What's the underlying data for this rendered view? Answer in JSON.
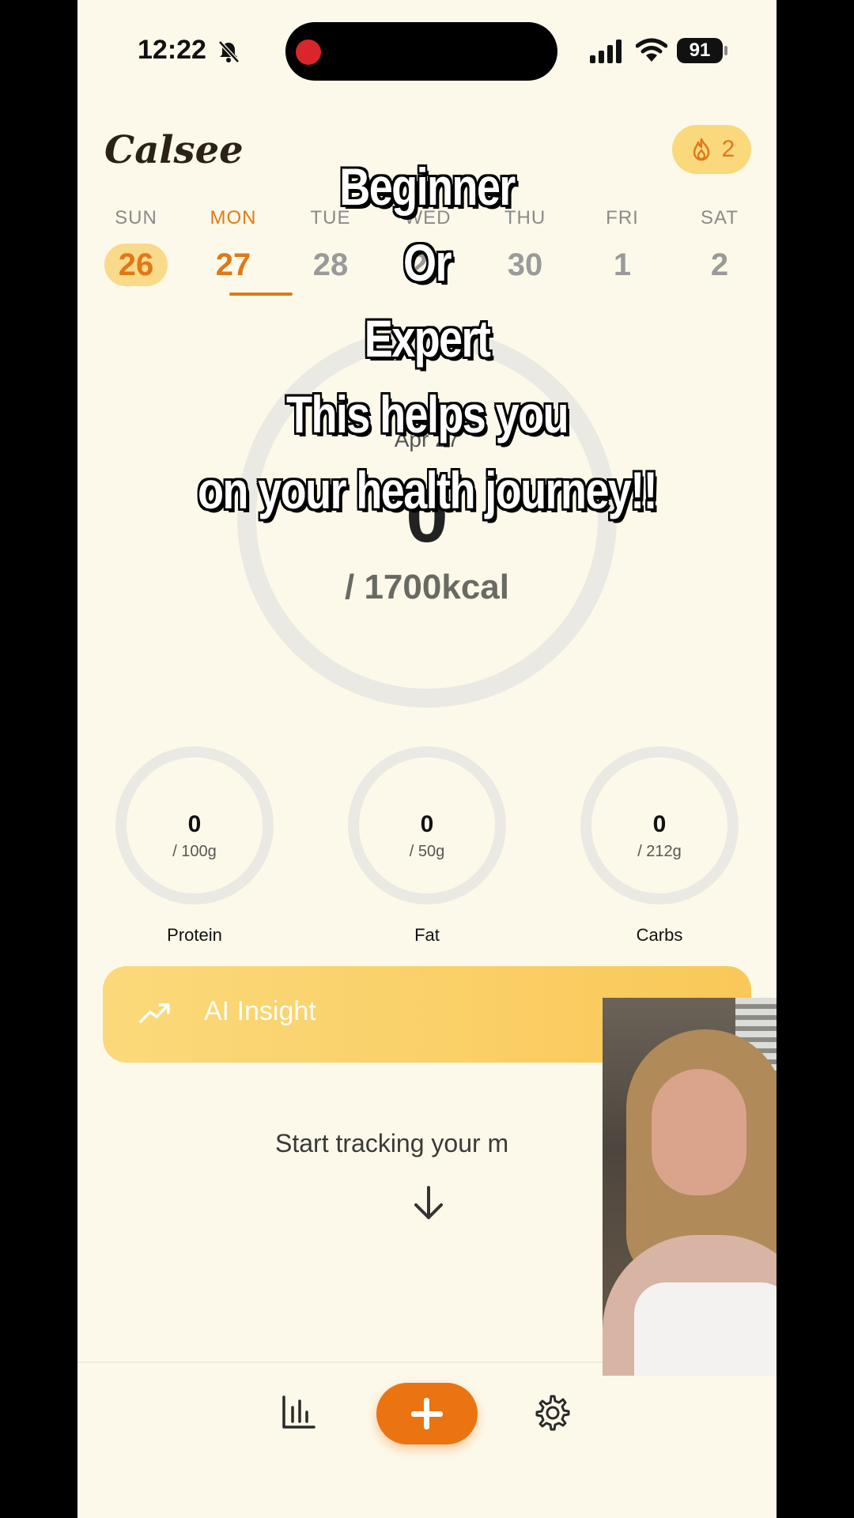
{
  "status_bar": {
    "time": "12:22",
    "battery": "91"
  },
  "header": {
    "app_title": "Calsee",
    "streak_count": "2"
  },
  "week": [
    {
      "name": "SUN",
      "num": "26"
    },
    {
      "name": "MON",
      "num": "27"
    },
    {
      "name": "TUE",
      "num": "28"
    },
    {
      "name": "WED",
      "num": "29"
    },
    {
      "name": "THU",
      "num": "30"
    },
    {
      "name": "FRI",
      "num": "1"
    },
    {
      "name": "SAT",
      "num": "2"
    }
  ],
  "calories": {
    "date": "Apr 27",
    "consumed": "0",
    "goal": "/ 1700kcal"
  },
  "macros": [
    {
      "label": "Protein",
      "value": "0",
      "goal": "/ 100g"
    },
    {
      "label": "Fat",
      "value": "0",
      "goal": "/ 50g"
    },
    {
      "label": "Carbs",
      "value": "0",
      "goal": "/ 212g"
    }
  ],
  "ai_insight": {
    "label": "AI Insight"
  },
  "empty_state": {
    "text": "Start tracking your m"
  },
  "captions": [
    "Beginner",
    "Or",
    "Expert",
    "This helps you",
    "on your health journey!!"
  ],
  "colors": {
    "accent": "#e07818",
    "background": "#fdf9ea",
    "insight_bar": "#f9c858"
  },
  "icons": [
    "bell-slash-icon",
    "signal-icon",
    "wifi-icon",
    "flame-icon",
    "trend-up-icon",
    "arrow-down-icon",
    "bar-chart-icon",
    "plus-icon",
    "gear-icon"
  ]
}
